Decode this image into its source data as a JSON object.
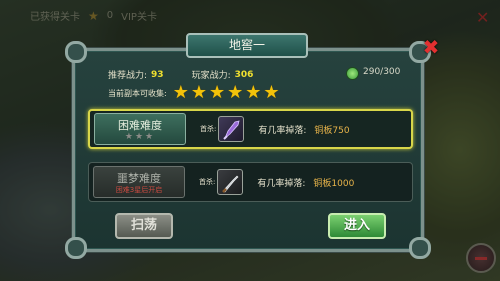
{
  "hud": {
    "left_text": "已获得关卡",
    "star_count": "0",
    "middle_text": "VIP关卡"
  },
  "dialog": {
    "title": "地窖一",
    "recommended_power_label": "推荐战力:",
    "recommended_power_value": "93",
    "player_power_label": "玩家战力:",
    "player_power_value": "306",
    "stamina_value": "290/300",
    "collectible_label": "当前副本可收集:",
    "collectible_stars": 6
  },
  "difficulties": [
    {
      "name": "困难难度",
      "stars": "★★★",
      "boss_label": "首杀:",
      "drop_label": "有几率掉落:",
      "drop_value": "铜板750",
      "selected": true
    },
    {
      "name": "噩梦难度",
      "note": "困难3星后开启",
      "boss_label": "首杀:",
      "drop_label": "有几率掉落:",
      "drop_value": "铜板1000",
      "selected": false
    }
  ],
  "buttons": {
    "sweep": "扫荡",
    "enter": "进入"
  },
  "colors": {
    "accent_gold": "#f2c20a",
    "highlight_border": "#d8d64a",
    "enter_green": "#2e8a36",
    "close_red": "#e23030"
  }
}
